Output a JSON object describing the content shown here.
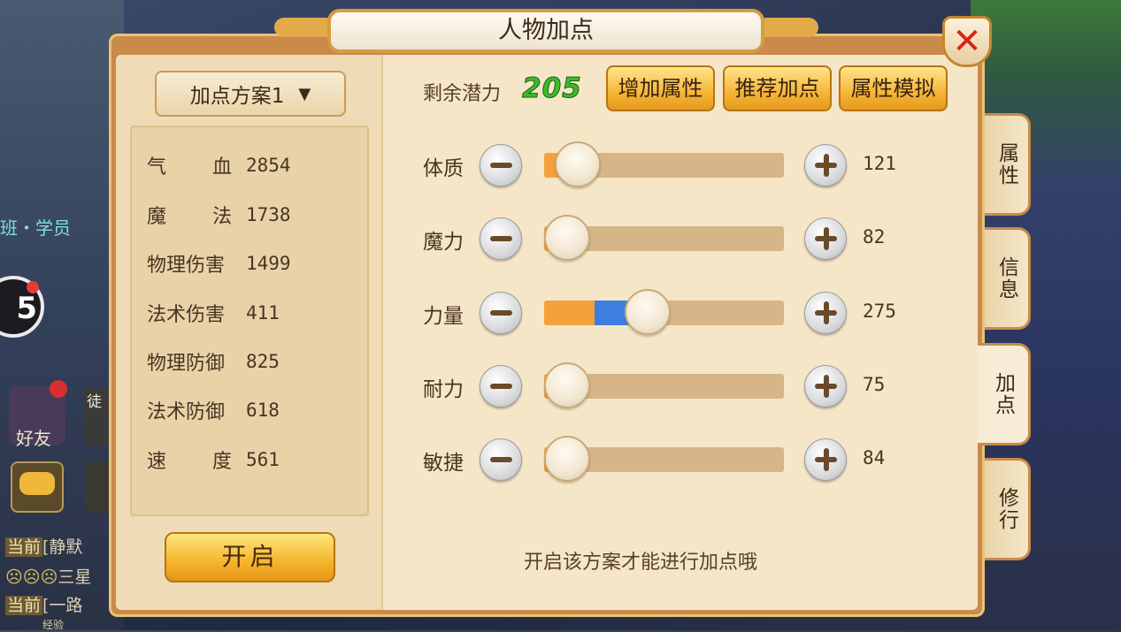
{
  "title": "人物加点",
  "close_icon": "close-icon",
  "scheme_selector": {
    "label": "加点方案1",
    "icon": "chevron-down-icon"
  },
  "stats": [
    {
      "label": "气血",
      "value": "2854",
      "spread": true
    },
    {
      "label": "魔法",
      "value": "1738",
      "spread": true
    },
    {
      "label": "物理伤害",
      "value": "1499",
      "spread": false
    },
    {
      "label": "法术伤害",
      "value": "411",
      "spread": false
    },
    {
      "label": "物理防御",
      "value": "825",
      "spread": false
    },
    {
      "label": "法术防御",
      "value": "618",
      "spread": false
    },
    {
      "label": "速度",
      "value": "561",
      "spread": true
    }
  ],
  "open_button": "开启",
  "potential": {
    "label": "剩余潜力",
    "value": "205"
  },
  "top_buttons": [
    "增加属性",
    "推荐加点",
    "属性模拟"
  ],
  "attributes": [
    {
      "label": "体质",
      "value": "121",
      "base_fraction": 0.14,
      "added_fraction": 0.0
    },
    {
      "label": "魔力",
      "value": "82",
      "base_fraction": 0.06,
      "added_fraction": 0.0
    },
    {
      "label": "力量",
      "value": "275",
      "base_fraction": 0.21,
      "added_fraction": 0.22
    },
    {
      "label": "耐力",
      "value": "75",
      "base_fraction": 0.05,
      "added_fraction": 0.0
    },
    {
      "label": "敏捷",
      "value": "84",
      "base_fraction": 0.06,
      "added_fraction": 0.0
    }
  ],
  "hint": "开启该方案才能进行加点哦",
  "side_tabs": [
    {
      "label": "属性",
      "active": false
    },
    {
      "label": "信息",
      "active": false
    },
    {
      "label": "加点",
      "active": true
    },
    {
      "label": "修行",
      "active": false
    }
  ],
  "background": {
    "guild_text": "班・学员",
    "friend_label": "好友",
    "apprentice_label": "徒",
    "chat": [
      {
        "tag": "当前",
        "text": "[静默"
      },
      {
        "tag": "",
        "text": "三星"
      },
      {
        "tag": "当前",
        "text": "[一路"
      }
    ],
    "exp_label": "经验"
  },
  "colors": {
    "accent": "#f5b233",
    "potential": "#3dbb2a",
    "fill_base": "#f3a138",
    "fill_added": "#3c7fe0",
    "close": "#d8231c"
  }
}
